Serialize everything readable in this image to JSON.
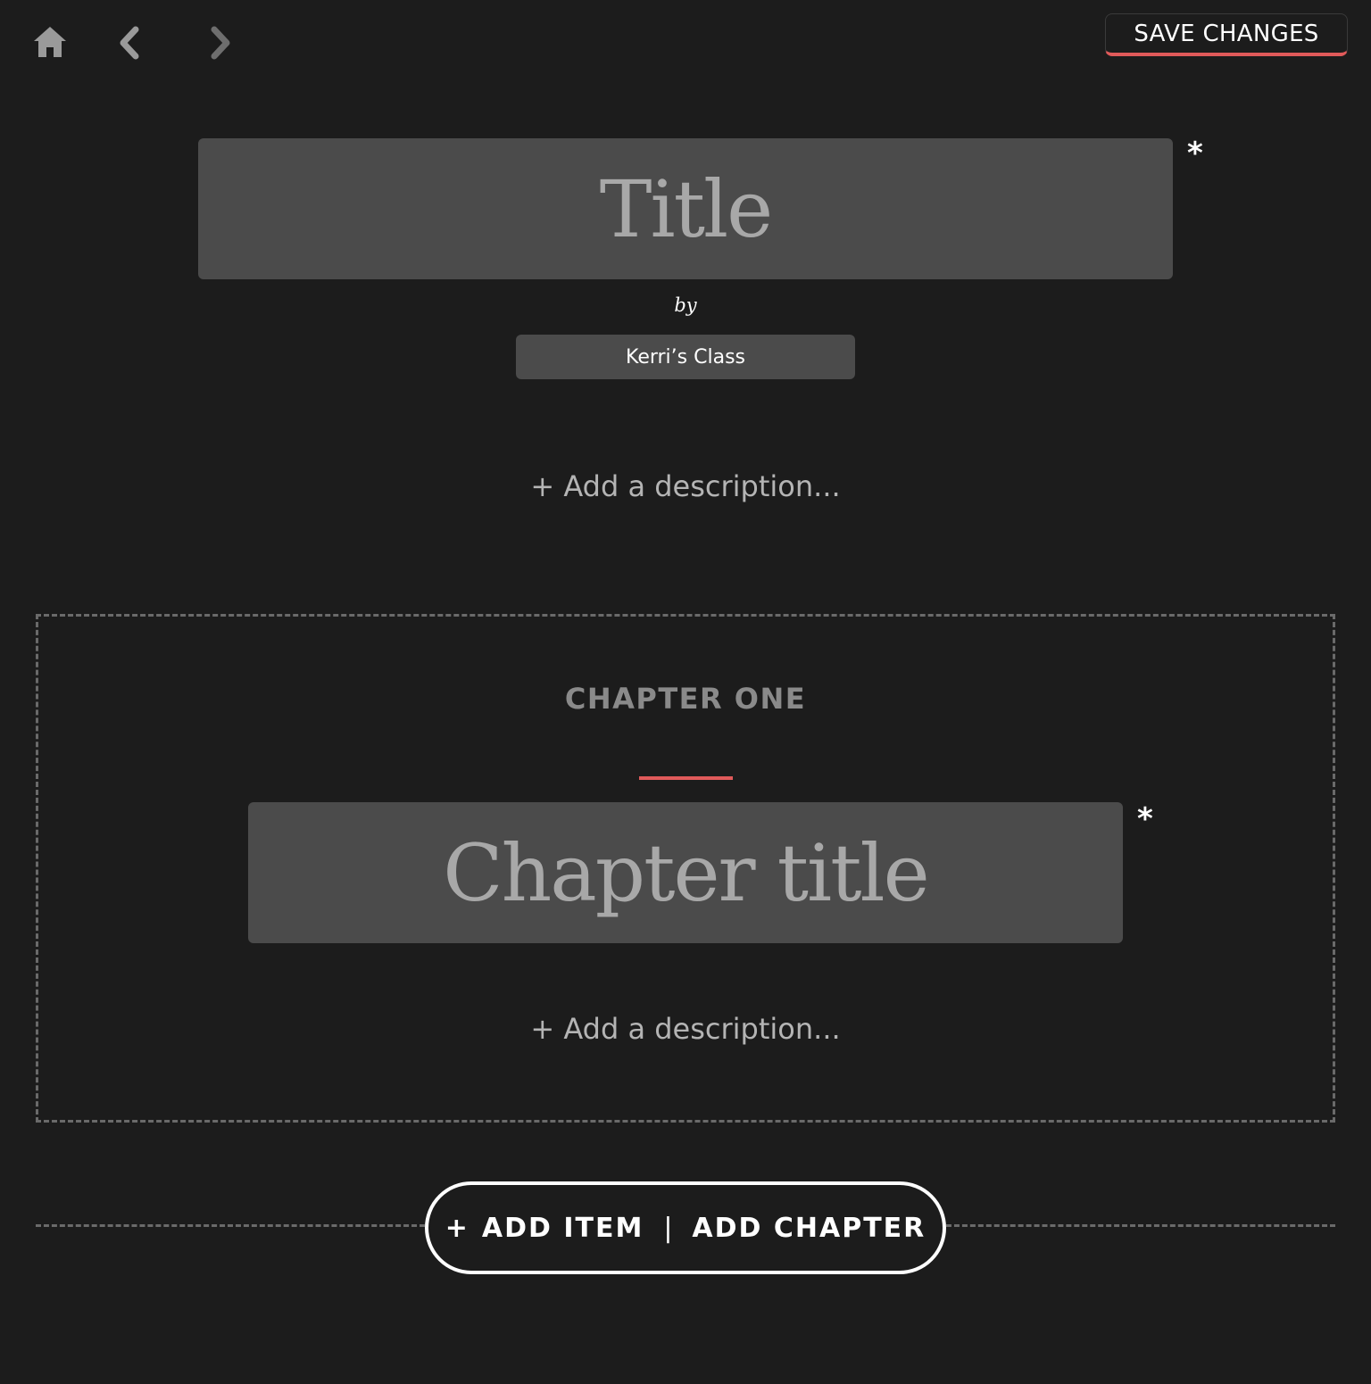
{
  "toolbar": {
    "home_icon": "home-icon",
    "back_icon": "chevron-left-icon",
    "forward_icon": "chevron-right-icon",
    "save_label": "SAVE CHANGES"
  },
  "book": {
    "title_placeholder": "Title",
    "title_value": "",
    "required_mark": "*",
    "by_label": "by",
    "author_value": "Kerri’s Class",
    "add_description_label": "+ Add a description..."
  },
  "chapter": {
    "label": "CHAPTER ONE",
    "title_placeholder": "Chapter title",
    "title_value": "",
    "required_mark": "*",
    "add_description_label": "+ Add a description..."
  },
  "add_bar": {
    "plus": "+",
    "add_item_label": "ADD ITEM",
    "separator": "|",
    "add_chapter_label": "ADD CHAPTER"
  },
  "colors": {
    "background": "#1c1c1c",
    "field": "#4b4b4b",
    "accent": "#e05a5a",
    "muted_text": "#8a8a8a",
    "placeholder": "#a8a8a8"
  }
}
